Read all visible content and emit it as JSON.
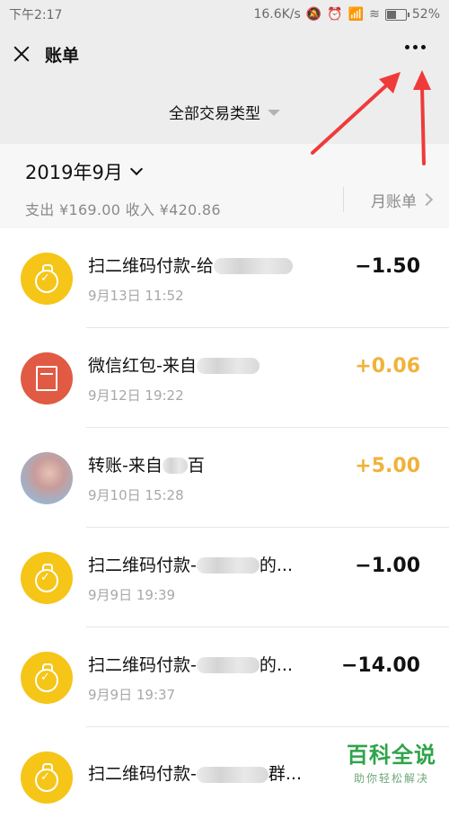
{
  "status_bar": {
    "time": "下午2:17",
    "speed": "16.6K/s",
    "battery": "52%",
    "battery_level": 0.52
  },
  "navbar": {
    "title": "账单"
  },
  "filter": {
    "label": "全部交易类型"
  },
  "month": {
    "title": "2019年9月",
    "summary": "支出 ¥169.00 收入 ¥420.86",
    "monthly_bill": "月账单"
  },
  "transactions": [
    {
      "title": "扫二维码付款-给",
      "time": "9月13日 11:52",
      "amount": "−1.50",
      "icon": "money-bag-icon",
      "type": "expense"
    },
    {
      "title": "微信红包-来自",
      "time": "9月12日 19:22",
      "amount": "+0.06",
      "icon": "red-packet-icon",
      "type": "income"
    },
    {
      "title": "转账-来自",
      "title_end": "百",
      "time": "9月10日 15:28",
      "amount": "+5.00",
      "icon": "avatar-photo",
      "type": "income"
    },
    {
      "title": "扫二维码付款-",
      "title_end": "的...",
      "time": "9月9日 19:39",
      "amount": "−1.00",
      "icon": "money-bag-icon",
      "type": "expense"
    },
    {
      "title": "扫二维码付款-",
      "title_end": "的...",
      "time": "9月9日 19:37",
      "amount": "−14.00",
      "icon": "money-bag-icon",
      "type": "expense"
    },
    {
      "title": "扫二维码付款-",
      "title_end": "群...",
      "time": "",
      "amount": "",
      "icon": "money-bag-icon",
      "type": "expense"
    }
  ],
  "watermark": {
    "main": "百科全说",
    "sub": "助你轻松解决"
  },
  "colors": {
    "income": "#f0b23a",
    "icon_yellow": "#f5c518",
    "icon_red": "#e05a44",
    "annotation_arrow": "#f03a3a",
    "watermark_green": "#2fa44a"
  }
}
